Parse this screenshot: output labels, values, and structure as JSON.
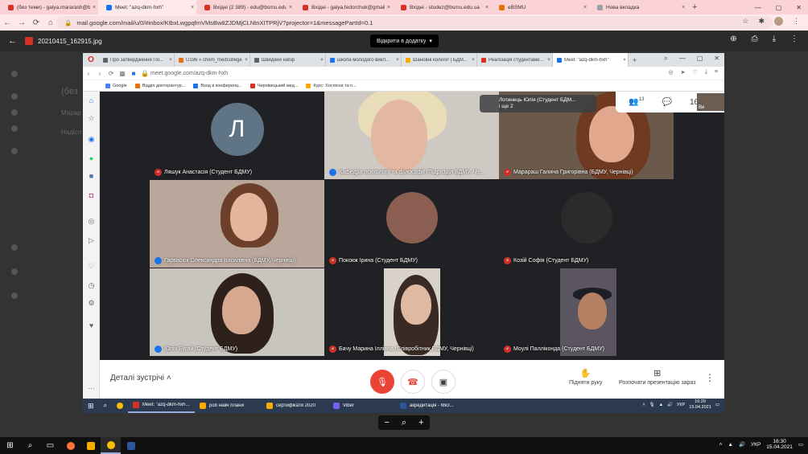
{
  "outer_tabs": [
    {
      "title": "(без теми) - galya.mararash@bsmu",
      "color": "#d93025",
      "active": false
    },
    {
      "title": "Meet: \"azq-dkm-hxh\"",
      "color": "#1a73e8",
      "active": true
    },
    {
      "title": "Вхідні (2 389) - edu@bsmu.edu.ua",
      "color": "#d93025",
      "active": false
    },
    {
      "title": "Вхідні - galya.fedorchuk@gmail.com",
      "color": "#d93025",
      "active": false
    },
    {
      "title": "Вхідні - studez@bsmu.edu.ua",
      "color": "#d93025",
      "active": false
    },
    {
      "title": "eBSMU",
      "color": "#e8710a",
      "active": false
    },
    {
      "title": "Нова вкладка",
      "color": "#9aa0a6",
      "active": false
    }
  ],
  "url": "mail.google.com/mail/u/0/#inbox/KtbxLwgpqfmVMsBw8ZJDMjCLNtnXITPRjV?projector=1&messagePartId=0.1",
  "viewer": {
    "filename": "20210415_162915.jpg",
    "open_with": "Відкрити в додатку"
  },
  "gmail_bg": {
    "text1": "(без",
    "text2": "Марар",
    "text3": "Надісл"
  },
  "inner_tabs": [
    {
      "title": "Про затвердження По...",
      "color": "#5f6368"
    },
    {
      "title": "U196 « chem_medcollege",
      "color": "#e8710a"
    },
    {
      "title": "Швидкий набір",
      "color": "#5f6368"
    },
    {
      "title": "школа молодого викл...",
      "color": "#1a73e8"
    },
    {
      "title": "Шановні колеги! | БДМ...",
      "color": "#f9ab00"
    },
    {
      "title": "Реалізація студентами...",
      "color": "#d93025"
    },
    {
      "title": "Meet: \"azq-dkm-hxh\"",
      "color": "#1a73e8",
      "active": true
    }
  ],
  "inner_url": "meet.google.com/azq-dkm-hxh",
  "bookmarks": [
    {
      "label": "Google",
      "color": "#4285f4"
    },
    {
      "label": "Відділ докторантур...",
      "color": "#e8710a"
    },
    {
      "label": "Вход в конференц...",
      "color": "#1a73e8"
    },
    {
      "label": "Чернівецький мед...",
      "color": "#d93025"
    },
    {
      "label": "Курс: Хоспісна та п...",
      "color": "#f9ab00"
    }
  ],
  "meet": {
    "pinned_name": "Лотинець Юлія (Студент БДМ...",
    "pinned_sub": "і ще 2",
    "people_count": "13",
    "time": "16:20",
    "self_label": "Ви",
    "participants": [
      {
        "name": "Ляшук Анастасія (Студент БДМУ)",
        "muted": true,
        "initial": "Л"
      },
      {
        "name": "Кафедра психології та філософії (Підрозділ БДМУ, Че...",
        "muted": false
      },
      {
        "name": "Марараш Галина Григорівна (БДМУ, Чернівці)",
        "muted": true
      },
      {
        "name": "Гарвасюк Олександра Василівна (БДМУ, Чернівці)",
        "muted": false
      },
      {
        "name": "Пококж Ірина (Студент БДМУ)",
        "muted": true
      },
      {
        "name": "Козій Софія (Студент БДМУ)",
        "muted": true
      },
      {
        "name": "Юлія Бугай (Студент БДМУ)",
        "muted": false
      },
      {
        "name": "Бачу Марина Іллівна (Співробітник,БДМУ, Чернівці)",
        "muted": true
      },
      {
        "name": "Моулі Паллікондa (Студент БДМУ)",
        "muted": true
      }
    ],
    "details_label": "Деталі зустрічі",
    "raise_hand": "Підняти руку",
    "present": "Розпочати презентацію зараз"
  },
  "inner_taskbar": [
    {
      "label": "Meet: \"azq-dkm-hxh...",
      "color": "#d93025"
    },
    {
      "label": "роб навч плани",
      "color": "#f9ab00"
    },
    {
      "label": "сертифікати 2020",
      "color": "#f9ab00"
    },
    {
      "label": "Viber",
      "color": "#7360f2"
    },
    {
      "label": "акредитація - Micr...",
      "color": "#2b579a"
    }
  ],
  "inner_tray": {
    "lang": "УКР",
    "time": "16:20",
    "date": "15.04.2021"
  },
  "outer_tray": {
    "lang": "УКР",
    "time": "16:30",
    "date": "15.04.2021"
  }
}
